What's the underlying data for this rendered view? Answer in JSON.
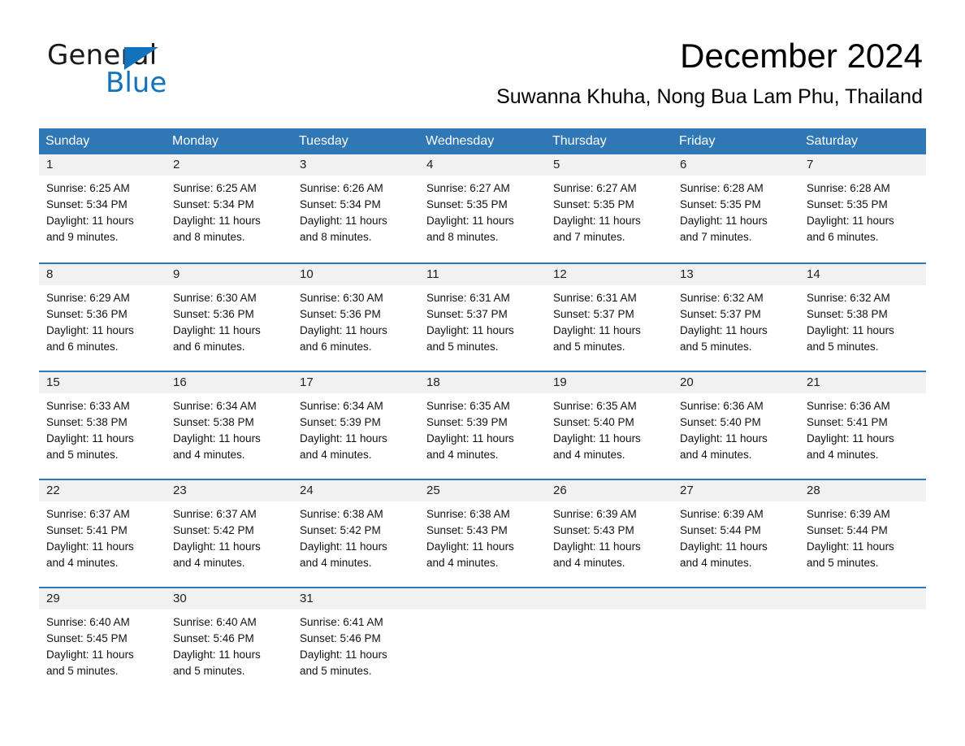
{
  "brand": {
    "name_part1": "General",
    "name_part2": "Blue",
    "triangle_color": "#1272bb"
  },
  "header": {
    "title": "December 2024",
    "subtitle": "Suwanna Khuha, Nong Bua Lam Phu, Thailand"
  },
  "theme": {
    "header_blue": "#2f77b5",
    "date_band_gray": "#f1f1f1",
    "logo_blue": "#1272bb"
  },
  "weekdays": [
    "Sunday",
    "Monday",
    "Tuesday",
    "Wednesday",
    "Thursday",
    "Friday",
    "Saturday"
  ],
  "weeks": [
    [
      {
        "day": "1",
        "sunrise": "Sunrise: 6:25 AM",
        "sunset": "Sunset: 5:34 PM",
        "daylight_line1": "Daylight: 11 hours",
        "daylight_line2": "and 9 minutes."
      },
      {
        "day": "2",
        "sunrise": "Sunrise: 6:25 AM",
        "sunset": "Sunset: 5:34 PM",
        "daylight_line1": "Daylight: 11 hours",
        "daylight_line2": "and 8 minutes."
      },
      {
        "day": "3",
        "sunrise": "Sunrise: 6:26 AM",
        "sunset": "Sunset: 5:34 PM",
        "daylight_line1": "Daylight: 11 hours",
        "daylight_line2": "and 8 minutes."
      },
      {
        "day": "4",
        "sunrise": "Sunrise: 6:27 AM",
        "sunset": "Sunset: 5:35 PM",
        "daylight_line1": "Daylight: 11 hours",
        "daylight_line2": "and 8 minutes."
      },
      {
        "day": "5",
        "sunrise": "Sunrise: 6:27 AM",
        "sunset": "Sunset: 5:35 PM",
        "daylight_line1": "Daylight: 11 hours",
        "daylight_line2": "and 7 minutes."
      },
      {
        "day": "6",
        "sunrise": "Sunrise: 6:28 AM",
        "sunset": "Sunset: 5:35 PM",
        "daylight_line1": "Daylight: 11 hours",
        "daylight_line2": "and 7 minutes."
      },
      {
        "day": "7",
        "sunrise": "Sunrise: 6:28 AM",
        "sunset": "Sunset: 5:35 PM",
        "daylight_line1": "Daylight: 11 hours",
        "daylight_line2": "and 6 minutes."
      }
    ],
    [
      {
        "day": "8",
        "sunrise": "Sunrise: 6:29 AM",
        "sunset": "Sunset: 5:36 PM",
        "daylight_line1": "Daylight: 11 hours",
        "daylight_line2": "and 6 minutes."
      },
      {
        "day": "9",
        "sunrise": "Sunrise: 6:30 AM",
        "sunset": "Sunset: 5:36 PM",
        "daylight_line1": "Daylight: 11 hours",
        "daylight_line2": "and 6 minutes."
      },
      {
        "day": "10",
        "sunrise": "Sunrise: 6:30 AM",
        "sunset": "Sunset: 5:36 PM",
        "daylight_line1": "Daylight: 11 hours",
        "daylight_line2": "and 6 minutes."
      },
      {
        "day": "11",
        "sunrise": "Sunrise: 6:31 AM",
        "sunset": "Sunset: 5:37 PM",
        "daylight_line1": "Daylight: 11 hours",
        "daylight_line2": "and 5 minutes."
      },
      {
        "day": "12",
        "sunrise": "Sunrise: 6:31 AM",
        "sunset": "Sunset: 5:37 PM",
        "daylight_line1": "Daylight: 11 hours",
        "daylight_line2": "and 5 minutes."
      },
      {
        "day": "13",
        "sunrise": "Sunrise: 6:32 AM",
        "sunset": "Sunset: 5:37 PM",
        "daylight_line1": "Daylight: 11 hours",
        "daylight_line2": "and 5 minutes."
      },
      {
        "day": "14",
        "sunrise": "Sunrise: 6:32 AM",
        "sunset": "Sunset: 5:38 PM",
        "daylight_line1": "Daylight: 11 hours",
        "daylight_line2": "and 5 minutes."
      }
    ],
    [
      {
        "day": "15",
        "sunrise": "Sunrise: 6:33 AM",
        "sunset": "Sunset: 5:38 PM",
        "daylight_line1": "Daylight: 11 hours",
        "daylight_line2": "and 5 minutes."
      },
      {
        "day": "16",
        "sunrise": "Sunrise: 6:34 AM",
        "sunset": "Sunset: 5:38 PM",
        "daylight_line1": "Daylight: 11 hours",
        "daylight_line2": "and 4 minutes."
      },
      {
        "day": "17",
        "sunrise": "Sunrise: 6:34 AM",
        "sunset": "Sunset: 5:39 PM",
        "daylight_line1": "Daylight: 11 hours",
        "daylight_line2": "and 4 minutes."
      },
      {
        "day": "18",
        "sunrise": "Sunrise: 6:35 AM",
        "sunset": "Sunset: 5:39 PM",
        "daylight_line1": "Daylight: 11 hours",
        "daylight_line2": "and 4 minutes."
      },
      {
        "day": "19",
        "sunrise": "Sunrise: 6:35 AM",
        "sunset": "Sunset: 5:40 PM",
        "daylight_line1": "Daylight: 11 hours",
        "daylight_line2": "and 4 minutes."
      },
      {
        "day": "20",
        "sunrise": "Sunrise: 6:36 AM",
        "sunset": "Sunset: 5:40 PM",
        "daylight_line1": "Daylight: 11 hours",
        "daylight_line2": "and 4 minutes."
      },
      {
        "day": "21",
        "sunrise": "Sunrise: 6:36 AM",
        "sunset": "Sunset: 5:41 PM",
        "daylight_line1": "Daylight: 11 hours",
        "daylight_line2": "and 4 minutes."
      }
    ],
    [
      {
        "day": "22",
        "sunrise": "Sunrise: 6:37 AM",
        "sunset": "Sunset: 5:41 PM",
        "daylight_line1": "Daylight: 11 hours",
        "daylight_line2": "and 4 minutes."
      },
      {
        "day": "23",
        "sunrise": "Sunrise: 6:37 AM",
        "sunset": "Sunset: 5:42 PM",
        "daylight_line1": "Daylight: 11 hours",
        "daylight_line2": "and 4 minutes."
      },
      {
        "day": "24",
        "sunrise": "Sunrise: 6:38 AM",
        "sunset": "Sunset: 5:42 PM",
        "daylight_line1": "Daylight: 11 hours",
        "daylight_line2": "and 4 minutes."
      },
      {
        "day": "25",
        "sunrise": "Sunrise: 6:38 AM",
        "sunset": "Sunset: 5:43 PM",
        "daylight_line1": "Daylight: 11 hours",
        "daylight_line2": "and 4 minutes."
      },
      {
        "day": "26",
        "sunrise": "Sunrise: 6:39 AM",
        "sunset": "Sunset: 5:43 PM",
        "daylight_line1": "Daylight: 11 hours",
        "daylight_line2": "and 4 minutes."
      },
      {
        "day": "27",
        "sunrise": "Sunrise: 6:39 AM",
        "sunset": "Sunset: 5:44 PM",
        "daylight_line1": "Daylight: 11 hours",
        "daylight_line2": "and 4 minutes."
      },
      {
        "day": "28",
        "sunrise": "Sunrise: 6:39 AM",
        "sunset": "Sunset: 5:44 PM",
        "daylight_line1": "Daylight: 11 hours",
        "daylight_line2": "and 5 minutes."
      }
    ],
    [
      {
        "day": "29",
        "sunrise": "Sunrise: 6:40 AM",
        "sunset": "Sunset: 5:45 PM",
        "daylight_line1": "Daylight: 11 hours",
        "daylight_line2": "and 5 minutes."
      },
      {
        "day": "30",
        "sunrise": "Sunrise: 6:40 AM",
        "sunset": "Sunset: 5:46 PM",
        "daylight_line1": "Daylight: 11 hours",
        "daylight_line2": "and 5 minutes."
      },
      {
        "day": "31",
        "sunrise": "Sunrise: 6:41 AM",
        "sunset": "Sunset: 5:46 PM",
        "daylight_line1": "Daylight: 11 hours",
        "daylight_line2": "and 5 minutes."
      },
      {
        "day": "",
        "sunrise": "",
        "sunset": "",
        "daylight_line1": "",
        "daylight_line2": ""
      },
      {
        "day": "",
        "sunrise": "",
        "sunset": "",
        "daylight_line1": "",
        "daylight_line2": ""
      },
      {
        "day": "",
        "sunrise": "",
        "sunset": "",
        "daylight_line1": "",
        "daylight_line2": ""
      },
      {
        "day": "",
        "sunrise": "",
        "sunset": "",
        "daylight_line1": "",
        "daylight_line2": ""
      }
    ]
  ]
}
